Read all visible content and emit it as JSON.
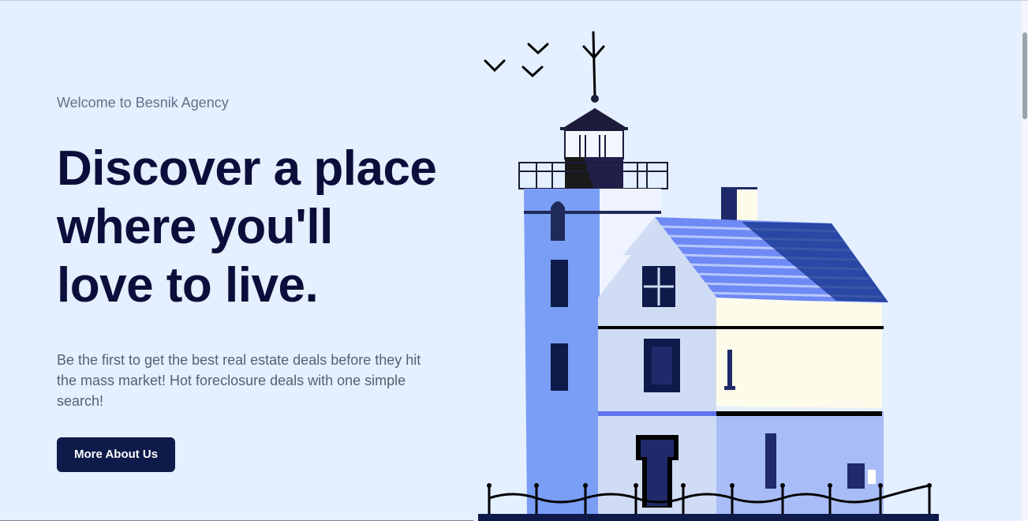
{
  "hero": {
    "eyebrow": "Welcome to Besnik Agency",
    "headline_lines": [
      "Discover a place",
      "where you'll",
      "love to live."
    ],
    "description": "Be the first to get the best real estate deals before they hit the mass market! Hot foreclosure deals with one simple search!",
    "cta_label": "More About Us"
  },
  "illustration": {
    "icon": "lighthouse-house-illustration",
    "colors": {
      "navy": "#0e1a4a",
      "tower_blue": "#7a9ef5",
      "wall_light": "#cfdcf3",
      "cream": "#fdfbe9",
      "roof_blue": "#6f8af4",
      "lower_right": "#a8bdf8"
    }
  },
  "colors": {
    "background": "#e4efff",
    "heading": "#0b0e3a",
    "eyebrow": "#64708a",
    "body": "#56606f",
    "button": "#0e1a4a"
  }
}
